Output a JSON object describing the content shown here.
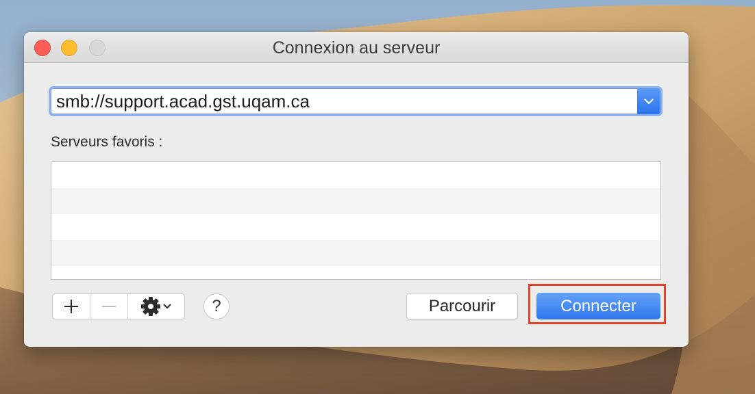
{
  "window": {
    "title": "Connexion au serveur"
  },
  "server_address": {
    "value": "smb://support.acad.gst.uqam.ca"
  },
  "favorites": {
    "label": "Serveurs favoris :",
    "rows": [
      "",
      "",
      "",
      "",
      ""
    ]
  },
  "toolbar": {
    "add_icon": "plus-icon",
    "remove_icon": "minus-icon",
    "actions_icon": "gear-icon",
    "help_label": "?"
  },
  "buttons": {
    "browse_label": "Parcourir",
    "connect_label": "Connecter"
  },
  "colors": {
    "accent": "#2f76ed",
    "highlight": "#e34326"
  }
}
